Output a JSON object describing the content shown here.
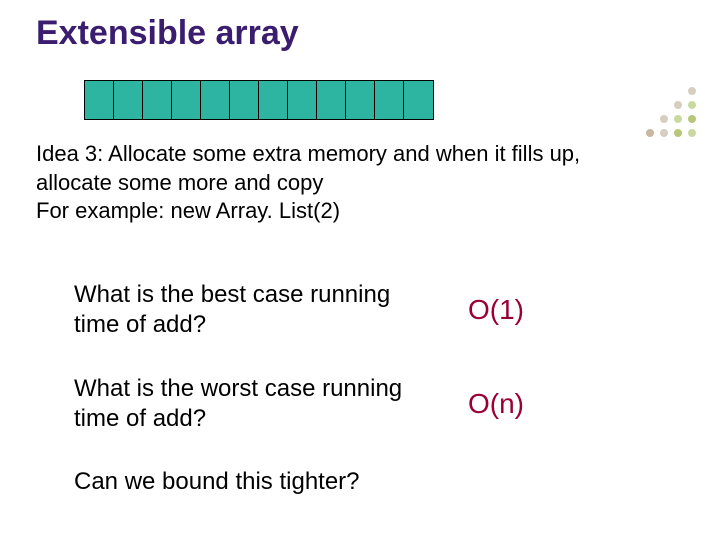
{
  "title": "Extensible array",
  "array_cells": 12,
  "colors": {
    "title": "#3a1d6e",
    "cell_fill": "#2eb5a2",
    "answer": "#990033"
  },
  "idea": {
    "line1": "Idea 3: Allocate some extra memory and when it fills up,",
    "line2": "allocate some more and copy",
    "line3": "For example:  new Array. List(2)"
  },
  "q1": {
    "text_line1": "What is the best case running",
    "text_line2": "time of add?",
    "answer": "O(1)"
  },
  "q2": {
    "text_line1": "What is the worst case running",
    "text_line2": "time of add?",
    "answer": "O(n)"
  },
  "q3": {
    "text": "Can we bound this tighter?"
  }
}
